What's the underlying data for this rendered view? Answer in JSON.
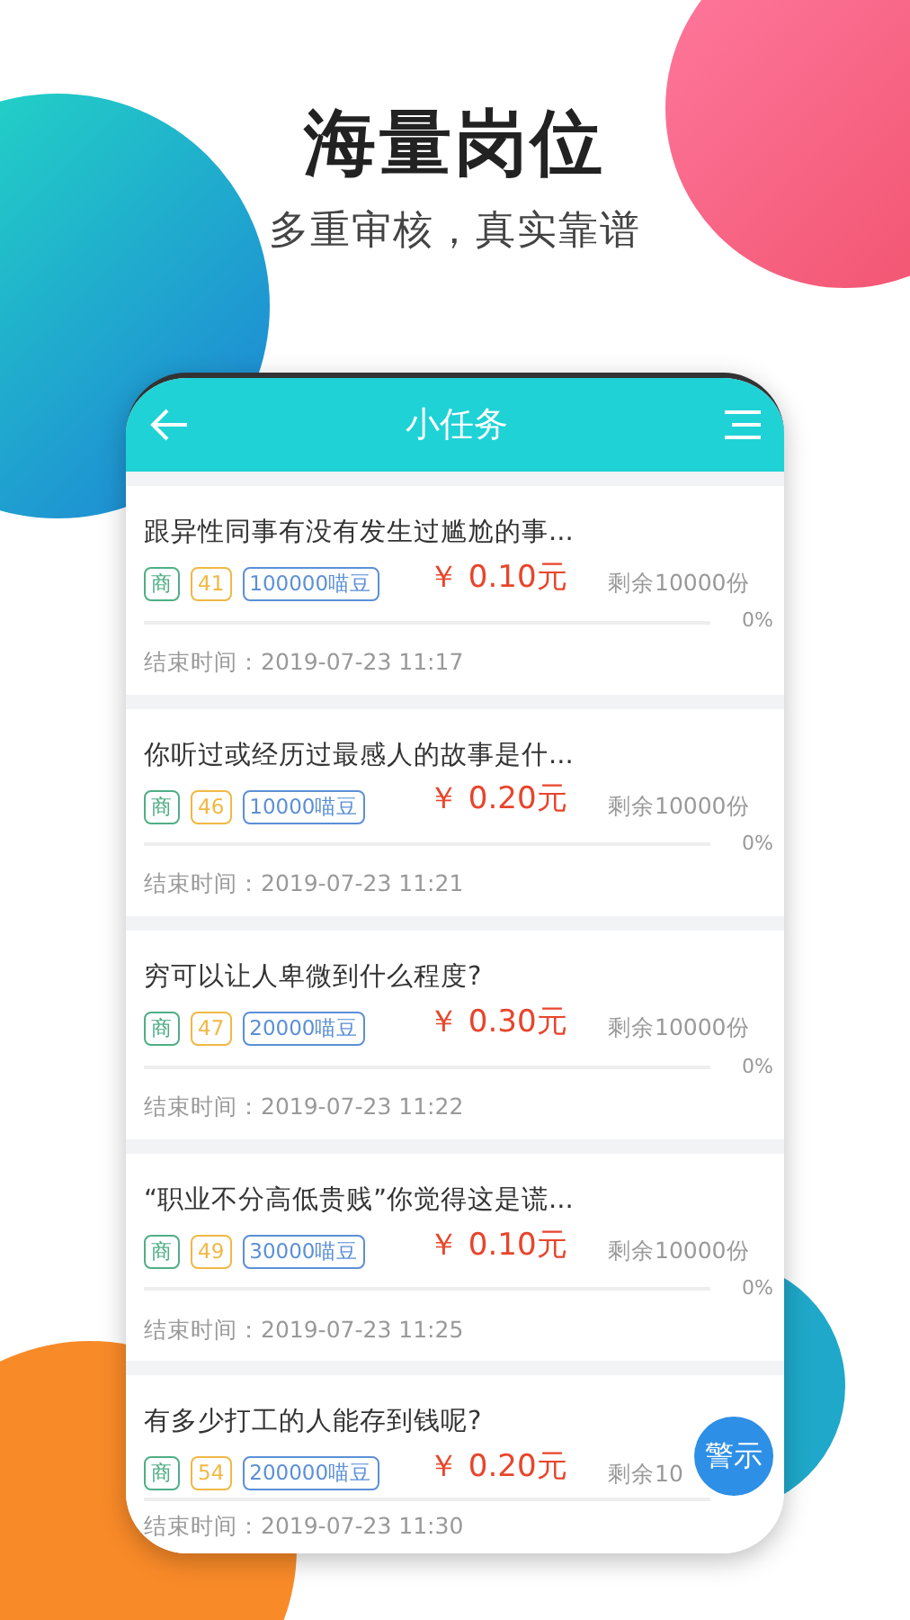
{
  "hero": {
    "title": "海量岗位",
    "subtitle": "多重审核，真实靠谱"
  },
  "app": {
    "title": "小任务"
  },
  "tasks": [
    {
      "title": "跟异性同事有没有发生过尴尬的事...",
      "tags": [
        {
          "text": "商",
          "color": "#4fae86"
        },
        {
          "text": "41",
          "color": "#f0b845"
        },
        {
          "text": "100000喵豆",
          "color": "#5b8fd6"
        }
      ],
      "price": "￥ 0.10元",
      "remaining": "剩余10000份",
      "level": 0,
      "percent": "0%",
      "end_time": "结束时间：2019-07-23 11:17"
    },
    {
      "title": "你听过或经历过最感人的故事是什...",
      "tags": [
        {
          "text": "商",
          "color": "#4fae86"
        },
        {
          "text": "46",
          "color": "#f0b845"
        },
        {
          "text": "10000喵豆",
          "color": "#5b8fd6"
        }
      ],
      "price": "￥ 0.20元",
      "remaining": "剩余10000份",
      "level": 0,
      "percent": "0%",
      "end_time": "结束时间：2019-07-23 11:21"
    },
    {
      "title": "穷可以让人卑微到什么程度?",
      "tags": [
        {
          "text": "商",
          "color": "#4fae86"
        },
        {
          "text": "47",
          "color": "#f0b845"
        },
        {
          "text": "20000喵豆",
          "color": "#5b8fd6"
        }
      ],
      "price": "￥ 0.30元",
      "remaining": "剩余10000份",
      "level": 0,
      "percent": "0%",
      "end_time": "结束时间：2019-07-23 11:22"
    },
    {
      "title": "“职业不分高低贵贱”你觉得这是谎...",
      "tags": [
        {
          "text": "商",
          "color": "#4fae86"
        },
        {
          "text": "49",
          "color": "#f0b845"
        },
        {
          "text": "30000喵豆",
          "color": "#5b8fd6"
        }
      ],
      "price": "￥ 0.10元",
      "remaining": "剩余10000份",
      "level": 0,
      "percent": "0%",
      "end_time": "结束时间：2019-07-23 11:25"
    },
    {
      "title": "有多少打工的人能存到钱呢?",
      "tags": [
        {
          "text": "商",
          "color": "#4fae86"
        },
        {
          "text": "54",
          "color": "#f0b845"
        },
        {
          "text": "200000喵豆",
          "color": "#5b8fd6"
        }
      ],
      "price": "￥ 0.20元",
      "remaining": "剩余10",
      "level": 0,
      "end_time": "结束时间：2019-07-23 11:30"
    }
  ],
  "alert_button": "警示"
}
